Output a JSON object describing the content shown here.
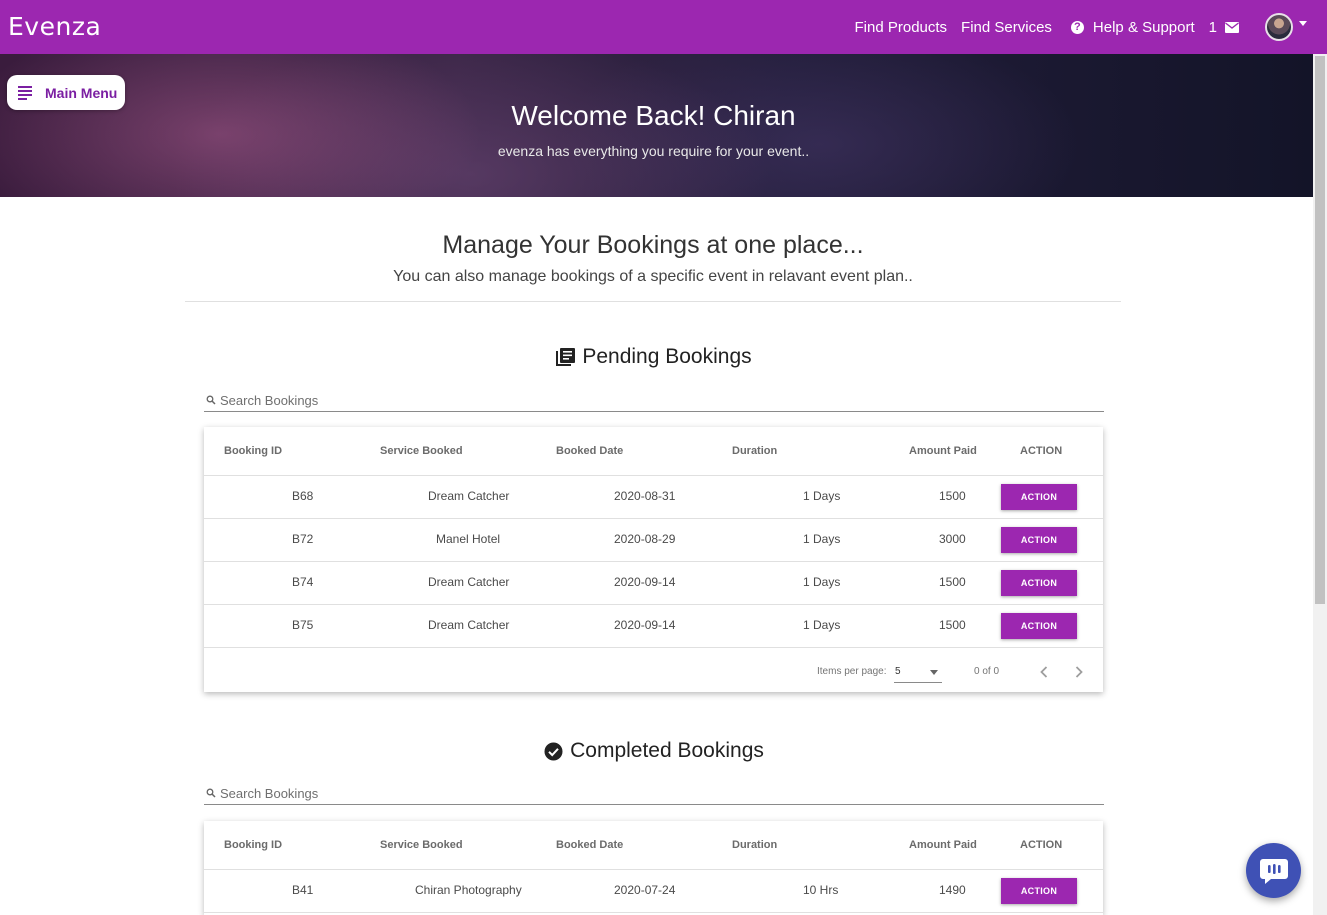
{
  "app": {
    "brand": "Evenza"
  },
  "nav": {
    "find_products": "Find Products",
    "find_services": "Find Services",
    "help_support": "Help & Support",
    "mail_count": "1"
  },
  "hero": {
    "title": "Welcome Back! Chiran",
    "subtitle": "evenza has everything you require for your event.."
  },
  "main_menu": {
    "label": "Main Menu"
  },
  "manage": {
    "title": "Manage Your Bookings at one place...",
    "subtitle": "You can also manage bookings of a specific event in relavant event plan.."
  },
  "table_headers": [
    "Booking ID",
    "Service Booked",
    "Booked Date",
    "Duration",
    "Amount Paid",
    "ACTION"
  ],
  "pending": {
    "heading": "Pending Bookings",
    "search_placeholder": "Search Bookings",
    "rows": [
      {
        "id": "B68",
        "service": "Dream Catcher",
        "date": "2020-08-31",
        "duration": "1 Days",
        "amount": "1500",
        "action": "ACTION"
      },
      {
        "id": "B72",
        "service": "Manel Hotel",
        "date": "2020-08-29",
        "duration": "1 Days",
        "amount": "3000",
        "action": "ACTION"
      },
      {
        "id": "B74",
        "service": "Dream Catcher",
        "date": "2020-09-14",
        "duration": "1 Days",
        "amount": "1500",
        "action": "ACTION"
      },
      {
        "id": "B75",
        "service": "Dream Catcher",
        "date": "2020-09-14",
        "duration": "1 Days",
        "amount": "1500",
        "action": "ACTION"
      }
    ],
    "paginator": {
      "items_per_page_label": "Items per page:",
      "items_per_page": "5",
      "range": "0 of 0"
    }
  },
  "completed": {
    "heading": "Completed Bookings",
    "search_placeholder": "Search Bookings",
    "rows": [
      {
        "id": "B41",
        "service": "Chiran Photography",
        "date": "2020-07-24",
        "duration": "10 Hrs",
        "amount": "1490",
        "action": "ACTION"
      }
    ]
  },
  "colors": {
    "primary": "#9c27b0",
    "chat": "#3f51b5"
  },
  "icons": [
    "menu-icon",
    "help-circle-icon",
    "mail-icon",
    "library-books-icon",
    "check-circle-icon",
    "search-icon",
    "chevron-left-icon",
    "chevron-right-icon",
    "chat-icon"
  ]
}
